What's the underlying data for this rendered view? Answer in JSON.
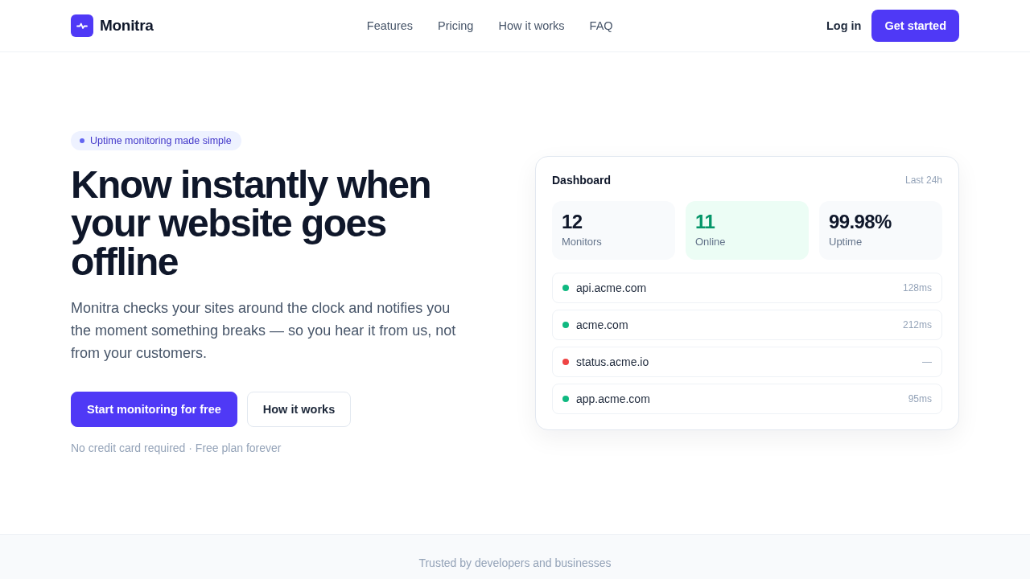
{
  "header": {
    "brand": "Monitra",
    "nav": [
      {
        "label": "Features"
      },
      {
        "label": "Pricing"
      },
      {
        "label": "How it works"
      },
      {
        "label": "FAQ"
      }
    ],
    "login": "Log in",
    "cta": "Get started"
  },
  "hero": {
    "badge": "Uptime monitoring made simple",
    "headline": "Know instantly when your website goes offline",
    "lead": "Monitra checks your sites around the clock and notifies you the moment something breaks — so you hear it from us, not from your customers.",
    "buttons": [
      {
        "kind": "primary",
        "label": "Start monitoring for free"
      },
      {
        "kind": "secondary",
        "label": "How it works"
      }
    ],
    "note": "No credit card required · Free plan forever"
  },
  "dashboard": {
    "title": "Dashboard",
    "period": "Last 24h",
    "stats": [
      {
        "kind": "neutral",
        "value": "12",
        "label": "Monitors"
      },
      {
        "kind": "success",
        "value": "11",
        "label": "Online"
      },
      {
        "kind": "neutral",
        "value": "99.98%",
        "label": "Uptime"
      }
    ],
    "monitors": [
      {
        "name": "api.acme.com",
        "latency": "128ms",
        "color": "#10b981"
      },
      {
        "name": "acme.com",
        "latency": "212ms",
        "color": "#10b981"
      },
      {
        "name": "status.acme.io",
        "latency": "—",
        "color": "#ef4444"
      },
      {
        "name": "app.acme.com",
        "latency": "95ms",
        "color": "#10b981"
      }
    ]
  },
  "trust_band": {
    "text": "Trusted by developers and businesses"
  }
}
